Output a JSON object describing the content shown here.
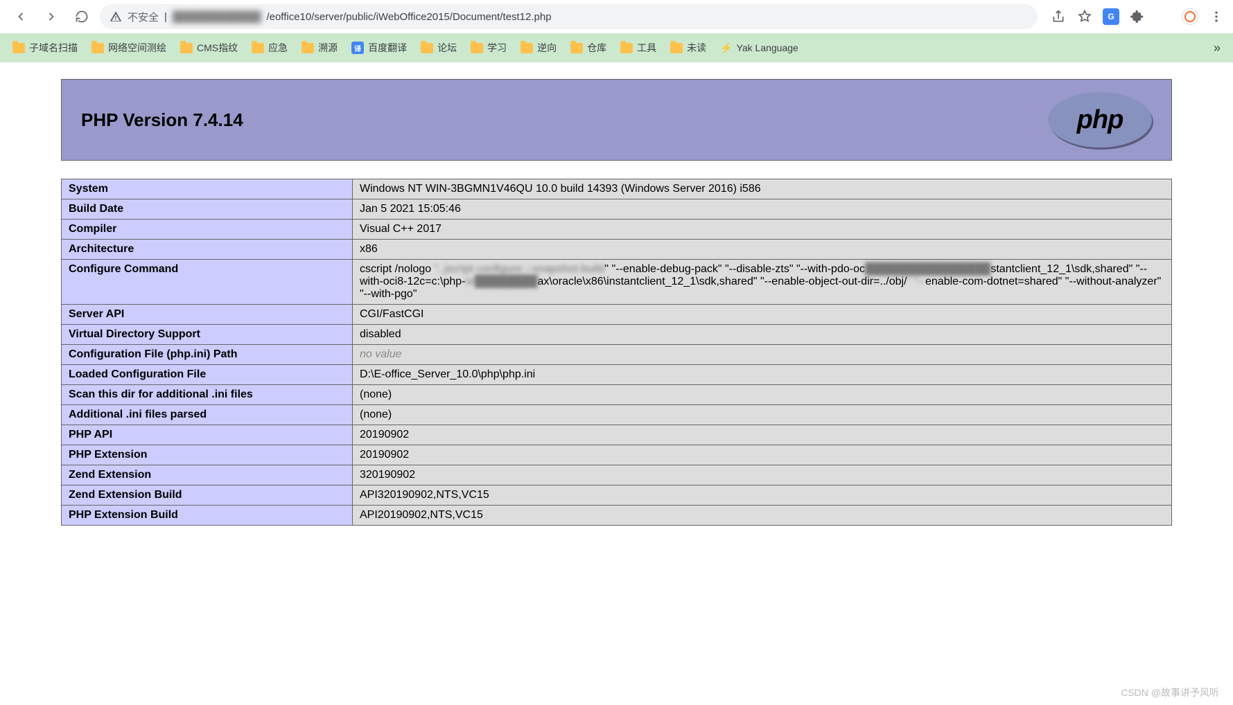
{
  "browser": {
    "insecure_label": "不安全",
    "url_visible": "/eoffice10/server/public/iWebOffice2015/Document/test12.php",
    "url_blurred": "████████████"
  },
  "bookmarks": [
    {
      "type": "folder",
      "label": "子域名扫描"
    },
    {
      "type": "folder",
      "label": "网络空间测绘"
    },
    {
      "type": "folder",
      "label": "CMS指纹"
    },
    {
      "type": "folder",
      "label": "应急"
    },
    {
      "type": "folder",
      "label": "溯源"
    },
    {
      "type": "translate",
      "label": "百度翻译"
    },
    {
      "type": "folder",
      "label": "论坛"
    },
    {
      "type": "folder",
      "label": "学习"
    },
    {
      "type": "folder",
      "label": "逆向"
    },
    {
      "type": "folder",
      "label": "仓库"
    },
    {
      "type": "folder",
      "label": "工具"
    },
    {
      "type": "folder",
      "label": "未读"
    },
    {
      "type": "yak",
      "label": "Yak Language"
    }
  ],
  "phpinfo": {
    "title": "PHP Version 7.4.14",
    "logo_text": "php",
    "rows": [
      {
        "k": "System",
        "v": "Windows NT WIN-3BGMN1V46QU 10.0 build 14393 (Windows Server 2016) i586"
      },
      {
        "k": "Build Date",
        "v": "Jan 5 2021 15:05:46"
      },
      {
        "k": "Compiler",
        "v": "Visual C++ 2017"
      },
      {
        "k": "Architecture",
        "v": "x86"
      },
      {
        "k": "Configure Command",
        "v_html": "cscript /nologo <span class='blur-seg'>\"..jscript configure</span> <span class='blur-seg'>--snapshot-build</span>\" \"--enable-debug-pack\" \"--disable-zts\" \"--with-pdo-oc<span class='blur-seg'>████████████████</span>stantclient_12_1\\sdk,shared\" \"--with-oci8-12c=c:\\php-<span class='blur-seg'>sr████████</span>ax\\oracle\\x86\\instantclient_12_1\\sdk,shared\" \"--enable-object-out-dir=../obj/<span class='blur-seg'>\" \"--</span>enable-com-dotnet=shared\" \"--without-analyzer\" \"--with-pgo\""
      },
      {
        "k": "Server API",
        "v": "CGI/FastCGI"
      },
      {
        "k": "Virtual Directory Support",
        "v": "disabled"
      },
      {
        "k": "Configuration File (php.ini) Path",
        "v_novalue": "no value"
      },
      {
        "k": "Loaded Configuration File",
        "v": "D:\\E-office_Server_10.0\\php\\php.ini"
      },
      {
        "k": "Scan this dir for additional .ini files",
        "v": "(none)"
      },
      {
        "k": "Additional .ini files parsed",
        "v": "(none)"
      },
      {
        "k": "PHP API",
        "v": "20190902"
      },
      {
        "k": "PHP Extension",
        "v": "20190902"
      },
      {
        "k": "Zend Extension",
        "v": "320190902"
      },
      {
        "k": "Zend Extension Build",
        "v": "API320190902,NTS,VC15"
      },
      {
        "k": "PHP Extension Build",
        "v": "API20190902,NTS,VC15"
      }
    ]
  },
  "watermark": "CSDN @故事讲予风听"
}
